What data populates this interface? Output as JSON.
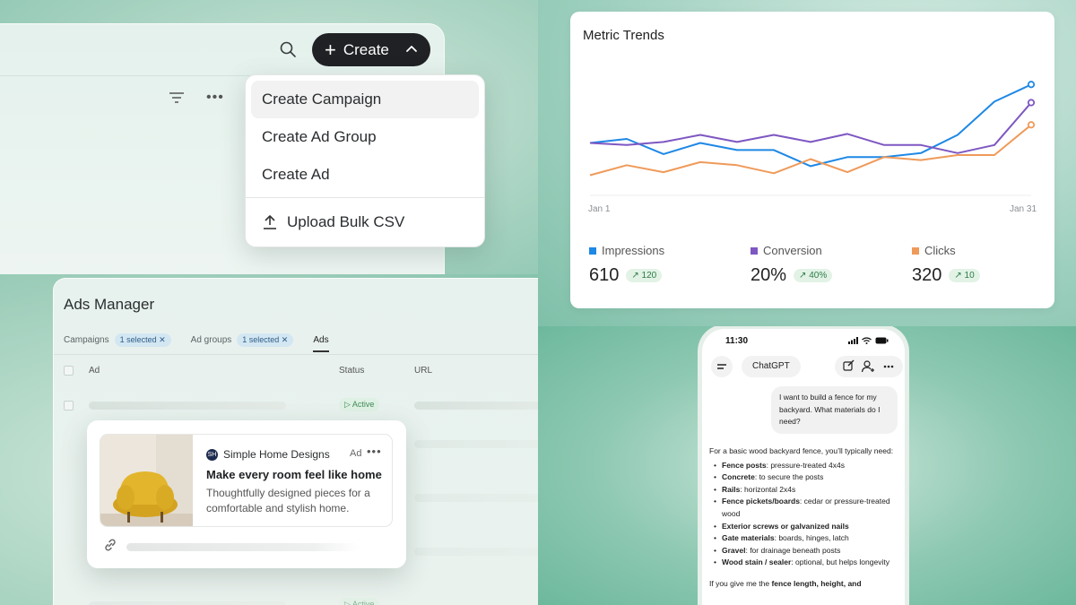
{
  "create_menu": {
    "create_label": "Create",
    "items": [
      {
        "label": "Create Campaign"
      },
      {
        "label": "Create Ad Group"
      },
      {
        "label": "Create Ad"
      }
    ],
    "upload_label": "Upload Bulk CSV"
  },
  "metrics": {
    "title": "Metric Trends",
    "x_start": "Jan 1",
    "x_end": "Jan 31",
    "stats": [
      {
        "name": "Impressions",
        "value": "610",
        "delta": "120",
        "color": "#1e88e5"
      },
      {
        "name": "Conversion",
        "value": "20%",
        "delta": "40%",
        "color": "#7e57c2"
      },
      {
        "name": "Clicks",
        "value": "320",
        "delta": "10",
        "color": "#ef9a5a"
      }
    ]
  },
  "chart_data": {
    "type": "line",
    "title": "Metric Trends",
    "xlabel": "",
    "ylabel": "",
    "x_tick_labels": [
      "Jan 1",
      "Jan 31"
    ],
    "grid": false,
    "legend": "bottom",
    "series": [
      {
        "name": "Impressions",
        "values": [
          52,
          56,
          41,
          52,
          45,
          45,
          29,
          38,
          38,
          42,
          60,
          93,
          110
        ],
        "color": "#1e88e5"
      },
      {
        "name": "Conversion",
        "values": [
          52,
          50,
          53,
          60,
          53,
          60,
          53,
          61,
          50,
          50,
          42,
          50,
          92
        ],
        "color": "#7e57c2"
      },
      {
        "name": "Clicks",
        "values": [
          20,
          30,
          23,
          33,
          30,
          22,
          36,
          23,
          38,
          35,
          40,
          40,
          70
        ],
        "color": "#ef9a5a"
      }
    ]
  },
  "ads_manager": {
    "title": "Ads Manager",
    "tabs": {
      "campaigns": "Campaigns",
      "campaigns_chip": "1 selected ✕",
      "ad_groups": "Ad groups",
      "ad_groups_chip": "1 selected ✕",
      "ads": "Ads"
    },
    "columns": {
      "ad": "Ad",
      "status": "Status",
      "url": "URL"
    },
    "status_active": "▷ Active",
    "ad_card": {
      "brand_logo": "SH",
      "brand": "Simple Home Designs",
      "ad_label": "Ad",
      "headline": "Make every room feel like home",
      "description": "Thoughtfully designed pieces for a comfortable and stylish home."
    }
  },
  "phone": {
    "time": "11:30",
    "model": "ChatGPT",
    "user_message": "I want to build a fence for my backyard. What materials do I need?",
    "answer_intro": "For a basic wood backyard fence, you’ll typically need:",
    "materials": [
      {
        "name": "Fence posts",
        "detail": ": pressure-treated 4x4s"
      },
      {
        "name": "Concrete",
        "detail": ": to secure the posts"
      },
      {
        "name": "Rails",
        "detail": ": horizontal 2x4s"
      },
      {
        "name": "Fence pickets/boards",
        "detail": ": cedar or pressure-treated wood"
      },
      {
        "name": "Exterior screws or galvanized nails",
        "detail": ""
      },
      {
        "name": "Gate materials",
        "detail": ": boards, hinges, latch"
      },
      {
        "name": "Gravel",
        "detail": ": for drainage beneath posts"
      },
      {
        "name": "Wood stain / sealer",
        "detail": ": optional, but helps longevity"
      }
    ],
    "answer_tail_start": "If you give me the ",
    "answer_tail_bold": "fence length, height, and"
  }
}
